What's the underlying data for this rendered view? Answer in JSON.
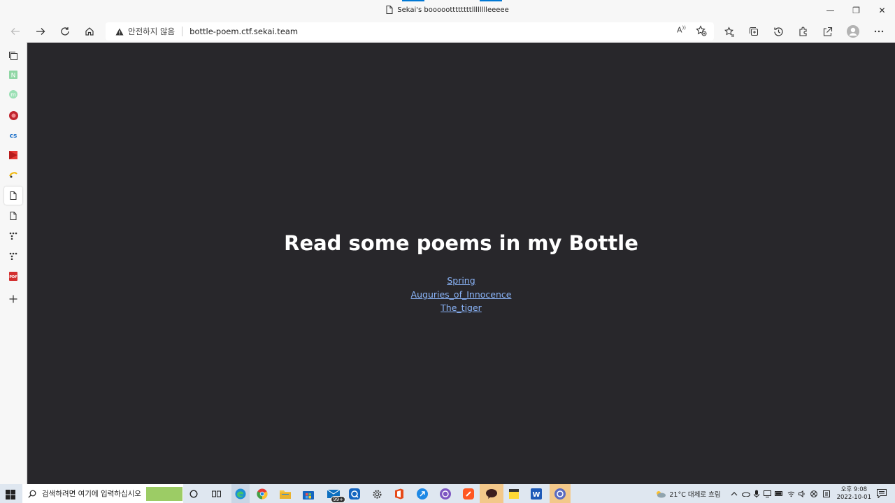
{
  "window": {
    "title": "Sekai's booooottttttttlllllllleeeee",
    "minimize": "—",
    "maximize": "❐",
    "close": "✕"
  },
  "address_bar": {
    "security_label": "안전하지 않음",
    "url": "bottle-poem.ctf.sekai.team"
  },
  "page": {
    "heading": "Read some poems in my Bottle",
    "links": [
      {
        "label": "Spring"
      },
      {
        "label": "Auguries_of_Innocence"
      },
      {
        "label": "The_tiger"
      }
    ]
  },
  "taskbar": {
    "search_placeholder": "검색하려면 여기에 입력하십시오",
    "weather": "21°C 대체로 흐림",
    "time": "오후 9:08",
    "date": "2022-10-01",
    "mail_badge": "99+"
  },
  "colors": {
    "page_bg": "#28272b",
    "link": "#8ab4f8",
    "accent": "#0078d4"
  }
}
